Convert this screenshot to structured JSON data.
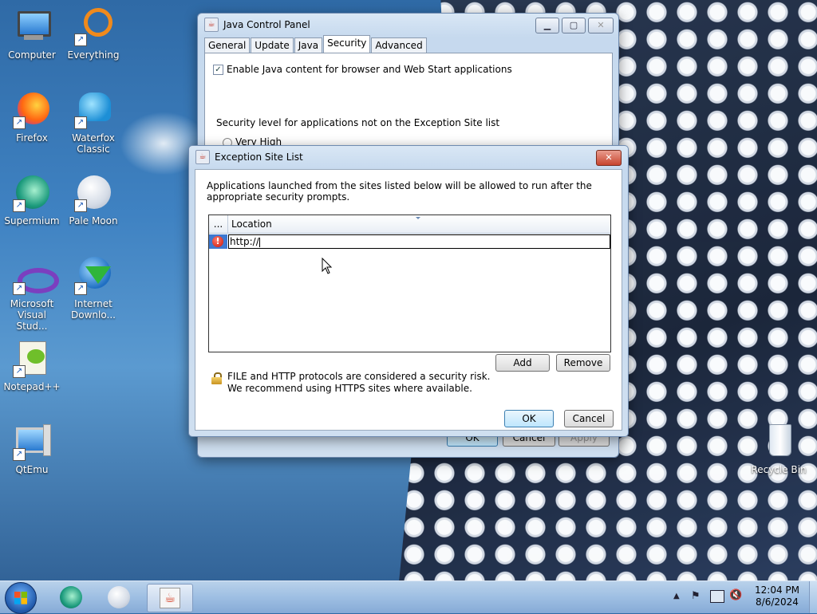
{
  "desktop": {
    "icons": [
      {
        "label": "Computer"
      },
      {
        "label": "Everything"
      },
      {
        "label": "Firefox"
      },
      {
        "label": "Waterfox Classic"
      },
      {
        "label": "Supermium"
      },
      {
        "label": "Pale Moon"
      },
      {
        "label": "Microsoft Visual Stud..."
      },
      {
        "label": "Internet Downlo..."
      },
      {
        "label": "Notepad++"
      },
      {
        "label": "QtEmu"
      },
      {
        "label": "Recycle Bin"
      }
    ]
  },
  "java_panel": {
    "title": "Java Control Panel",
    "tabs": [
      "General",
      "Update",
      "Java",
      "Security",
      "Advanced"
    ],
    "active_tab": "Security",
    "enable_checkbox_label": "Enable Java content for browser and Web Start applications",
    "enable_checked": true,
    "security_level_label": "Security level for applications not on the Exception Site list",
    "radio_very_high": "Very High",
    "buttons": {
      "ok": "OK",
      "cancel": "Cancel",
      "apply": "Apply"
    }
  },
  "exception_dialog": {
    "title": "Exception Site List",
    "description": "Applications launched from the sites listed below will be allowed to run after the appropriate security prompts.",
    "table": {
      "col1_header": "...",
      "col2_header": "Location",
      "rows": [
        {
          "status_icon": "error-icon",
          "value": "http://"
        }
      ]
    },
    "buttons": {
      "add": "Add",
      "remove": "Remove",
      "ok": "OK",
      "cancel": "Cancel"
    },
    "warning_line1": "FILE and HTTP protocols are considered a security risk.",
    "warning_line2": "We recommend using HTTPS sites where available."
  },
  "taskbar": {
    "time": "12:04 PM",
    "date": "8/6/2024"
  }
}
